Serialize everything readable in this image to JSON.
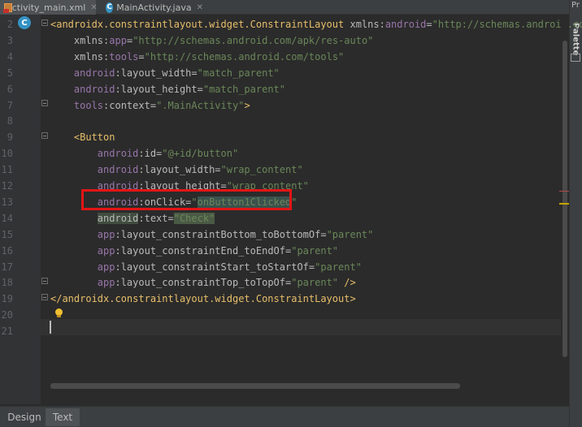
{
  "tabs": [
    {
      "label": "activity_main.xml",
      "icon": "xml-file-icon",
      "active": true
    },
    {
      "label": "MainActivity.java",
      "icon": "java-class-icon",
      "active": false
    }
  ],
  "right_panel": {
    "top_label": "Pr",
    "palette_label": "Palette"
  },
  "gutter_badge": "C",
  "code_lines": [
    {
      "n": "2",
      "segs": [
        [
          "tag",
          "<androidx.constraintlayout.widget.ConstraintLayout "
        ],
        [
          "attr",
          "xmlns:"
        ],
        [
          "ns",
          "android"
        ],
        [
          "attr",
          "="
        ],
        [
          "val",
          "\"http://schemas.android.com/"
        ]
      ]
    },
    {
      "n": "3",
      "segs": [
        [
          "txt",
          "    "
        ],
        [
          "attr",
          "xmlns:"
        ],
        [
          "ns",
          "app"
        ],
        [
          "attr",
          "="
        ],
        [
          "val",
          "\"http://schemas.android.com/apk/res-auto\""
        ]
      ]
    },
    {
      "n": "4",
      "segs": [
        [
          "txt",
          "    "
        ],
        [
          "attr",
          "xmlns:"
        ],
        [
          "ns",
          "tools"
        ],
        [
          "attr",
          "="
        ],
        [
          "val",
          "\"http://schemas.android.com/tools\""
        ]
      ]
    },
    {
      "n": "5",
      "segs": [
        [
          "txt",
          "    "
        ],
        [
          "ns",
          "android"
        ],
        [
          "attr",
          ":layout_width="
        ],
        [
          "val",
          "\"match_parent\""
        ]
      ]
    },
    {
      "n": "6",
      "segs": [
        [
          "txt",
          "    "
        ],
        [
          "ns",
          "android"
        ],
        [
          "attr",
          ":layout_height="
        ],
        [
          "val",
          "\"match_parent\""
        ]
      ]
    },
    {
      "n": "7",
      "segs": [
        [
          "txt",
          "    "
        ],
        [
          "ns",
          "tools"
        ],
        [
          "attr",
          ":context="
        ],
        [
          "val",
          "\".MainActivity\""
        ],
        [
          "tag",
          ">"
        ]
      ]
    },
    {
      "n": "8",
      "segs": []
    },
    {
      "n": "9",
      "segs": [
        [
          "txt",
          "    "
        ],
        [
          "tag",
          "<Button"
        ]
      ]
    },
    {
      "n": "10",
      "segs": [
        [
          "txt",
          "        "
        ],
        [
          "ns",
          "android"
        ],
        [
          "attr",
          ":id="
        ],
        [
          "val",
          "\"@+id/button\""
        ]
      ]
    },
    {
      "n": "11",
      "segs": [
        [
          "txt",
          "        "
        ],
        [
          "ns",
          "android"
        ],
        [
          "attr",
          ":layout_width="
        ],
        [
          "val",
          "\"wrap_content\""
        ]
      ]
    },
    {
      "n": "12",
      "segs": [
        [
          "txt",
          "        "
        ],
        [
          "ns",
          "android"
        ],
        [
          "attr",
          ":layout_height="
        ],
        [
          "val",
          "\"wrap_content\""
        ]
      ]
    },
    {
      "n": "13",
      "segs": [
        [
          "txt",
          "        "
        ],
        [
          "ns",
          "android"
        ],
        [
          "attr",
          ":onClick="
        ],
        [
          "val",
          "\""
        ],
        [
          "val-hl",
          "onButton1Clicked"
        ],
        [
          "val",
          "\""
        ]
      ]
    },
    {
      "n": "14",
      "segs": [
        [
          "txt",
          "        "
        ],
        [
          "attr-hl",
          "android"
        ],
        [
          "attr",
          ":text="
        ],
        [
          "val-sel",
          "\"Check\""
        ]
      ]
    },
    {
      "n": "15",
      "segs": [
        [
          "txt",
          "        "
        ],
        [
          "ns",
          "app"
        ],
        [
          "attr",
          ":layout_constraintBottom_toBottomOf="
        ],
        [
          "val",
          "\"parent\""
        ]
      ]
    },
    {
      "n": "16",
      "segs": [
        [
          "txt",
          "        "
        ],
        [
          "ns",
          "app"
        ],
        [
          "attr",
          ":layout_constraintEnd_toEndOf="
        ],
        [
          "val",
          "\"parent\""
        ]
      ]
    },
    {
      "n": "17",
      "segs": [
        [
          "txt",
          "        "
        ],
        [
          "ns",
          "app"
        ],
        [
          "attr",
          ":layout_constraintStart_toStartOf="
        ],
        [
          "val",
          "\"parent\""
        ]
      ]
    },
    {
      "n": "18",
      "segs": [
        [
          "txt",
          "        "
        ],
        [
          "ns",
          "app"
        ],
        [
          "attr",
          ":layout_constraintTop_toTopOf="
        ],
        [
          "val",
          "\"parent\""
        ],
        [
          "tag",
          " />"
        ]
      ]
    },
    {
      "n": "19",
      "segs": [
        [
          "tag",
          "</androidx.constraintlayout.widget.ConstraintLayout>"
        ]
      ]
    },
    {
      "n": "20",
      "segs": []
    },
    {
      "n": "21",
      "segs": []
    }
  ],
  "bottom_tabs": [
    {
      "label": "Design",
      "active": false
    },
    {
      "label": "Text",
      "active": true
    }
  ],
  "colors": {
    "tag": "#e8bf6a",
    "attribute": "#bababa",
    "namespace": "#9876aa",
    "value": "#6a8759",
    "highlight_box": "#e21515"
  }
}
